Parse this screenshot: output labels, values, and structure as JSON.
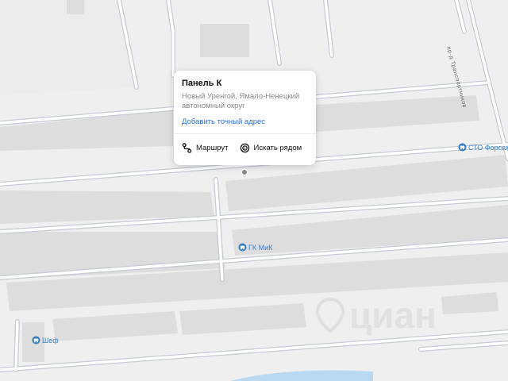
{
  "popup": {
    "title": "Панель К",
    "address": "Новый Уренгой, Ямало-Ненецкий автономный округ",
    "link_label": "Добавить точный адрес",
    "actions": [
      {
        "label": "Маршрут",
        "icon": "route-icon"
      },
      {
        "label": "Искать рядом",
        "icon": "search-nearby-icon"
      }
    ]
  },
  "pois": [
    {
      "label": "СТО Форсаж",
      "icon": "car-service-icon"
    },
    {
      "label": "ГК МиК",
      "icon": "car-service-icon"
    },
    {
      "label": "Шеф",
      "icon": "car-service-icon"
    }
  ],
  "street_label": "пр-д Транспортников",
  "watermark": "циан",
  "colors": {
    "background": "#efefef",
    "road": "#ffffff",
    "road_edge": "#c6cad3",
    "building": "#dcdcdc",
    "poi": "#3a7fc1",
    "link": "#2b6fd6",
    "water": "#b9d8f2"
  }
}
